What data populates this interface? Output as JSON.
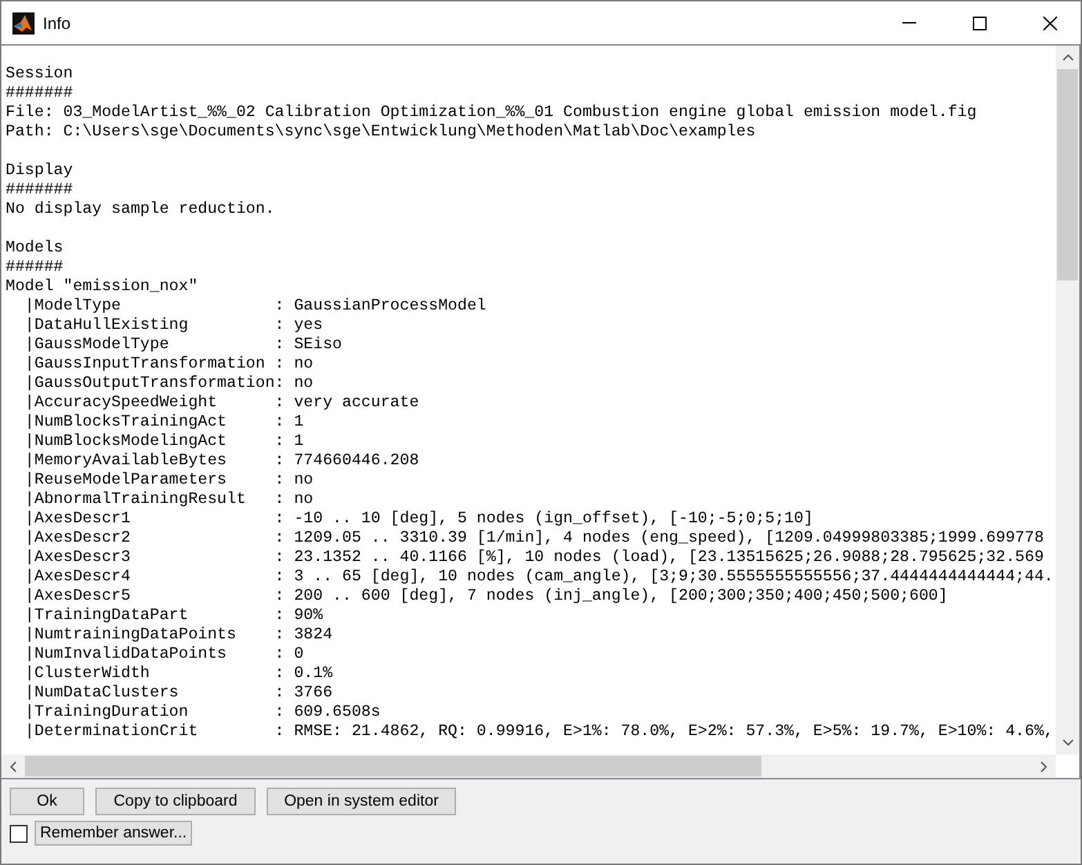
{
  "window": {
    "title": "Info"
  },
  "sections": [
    {
      "lines": [
        "Session",
        "#######",
        "File: 03_ModelArtist_%%_02 Calibration Optimization_%%_01 Combustion engine global emission model.fig",
        "Path: C:\\Users\\sge\\Documents\\sync\\sge\\Entwicklung\\Methoden\\Matlab\\Doc\\examples"
      ]
    },
    {
      "lines": [
        "Display",
        "#######",
        "No display sample reduction."
      ]
    },
    {
      "lines": [
        "Models",
        "######",
        "Model \"emission_nox\"",
        "  |ModelType                : GaussianProcessModel",
        "  |DataHullExisting         : yes",
        "  |GaussModelType           : SEiso",
        "  |GaussInputTransformation : no",
        "  |GaussOutputTransformation: no",
        "  |AccuracySpeedWeight      : very accurate",
        "  |NumBlocksTrainingAct     : 1",
        "  |NumBlocksModelingAct     : 1",
        "  |MemoryAvailableBytes     : 774660446.208",
        "  |ReuseModelParameters     : no",
        "  |AbnormalTrainingResult   : no",
        "  |AxesDescr1               : -10 .. 10 [deg], 5 nodes (ign_offset), [-10;-5;0;5;10]",
        "  |AxesDescr2               : 1209.05 .. 3310.39 [1/min], 4 nodes (eng_speed), [1209.04999803385;1999.699778",
        "  |AxesDescr3               : 23.1352 .. 40.1166 [%], 10 nodes (load), [23.13515625;26.9088;28.795625;32.569",
        "  |AxesDescr4               : 3 .. 65 [deg], 10 nodes (cam_angle), [3;9;30.5555555555556;37.4444444444444;44.",
        "  |AxesDescr5               : 200 .. 600 [deg], 7 nodes (inj_angle), [200;300;350;400;450;500;600]",
        "  |TrainingDataPart         : 90%",
        "  |NumtrainingDataPoints    : 3824",
        "  |NumInvalidDataPoints     : 0",
        "  |ClusterWidth             : 0.1%",
        "  |NumDataClusters          : 3766",
        "  |TrainingDuration         : 609.6508s",
        "  |DeterminationCrit        : RMSE: 21.4862, RQ: 0.99916, E>1%: 78.0%, E>2%: 57.3%, E>5%: 19.7%, E>10%: 4.6%,"
      ]
    }
  ],
  "buttons": [
    "Ok",
    "Copy to clipboard",
    "Open in system editor"
  ],
  "remember": {
    "label": "Remember answer...",
    "checked": false
  }
}
